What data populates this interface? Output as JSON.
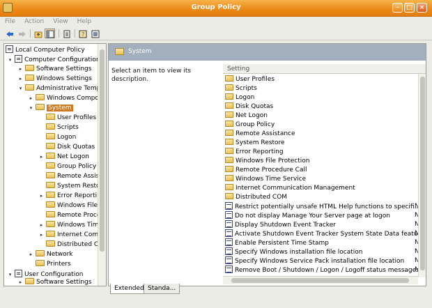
{
  "window": {
    "title": "Group Policy"
  },
  "menu": [
    "File",
    "Action",
    "View",
    "Help"
  ],
  "toolbar": [
    "back-icon",
    "forward-icon",
    "up-folder-icon",
    "show-hide-tree-icon",
    "properties-icon",
    "help-icon",
    "export-list-icon"
  ],
  "tree": [
    {
      "label": "Local Computer Policy",
      "icon": "policy",
      "expander": ""
    },
    {
      "label": "Computer Configuration",
      "icon": "computer",
      "expander": "▾"
    },
    {
      "label": "Software Settings",
      "icon": "folder",
      "expander": "▸"
    },
    {
      "label": "Windows Settings",
      "icon": "folder",
      "expander": "▸"
    },
    {
      "label": "Administrative Templ",
      "icon": "folder",
      "expander": "▾"
    },
    {
      "label": "Windows Compo",
      "icon": "folder",
      "expander": "▸"
    },
    {
      "label": "System",
      "icon": "folder",
      "expander": "▾",
      "selected": true
    },
    {
      "label": "User Profiles",
      "icon": "folder",
      "expander": ""
    },
    {
      "label": "Scripts",
      "icon": "folder",
      "expander": ""
    },
    {
      "label": "Logon",
      "icon": "folder",
      "expander": ""
    },
    {
      "label": "Disk Quotas",
      "icon": "folder",
      "expander": ""
    },
    {
      "label": "Net Logon",
      "icon": "folder",
      "expander": "▸"
    },
    {
      "label": "Group Policy",
      "icon": "folder",
      "expander": ""
    },
    {
      "label": "Remote Assist",
      "icon": "folder",
      "expander": ""
    },
    {
      "label": "System Restor",
      "icon": "folder",
      "expander": ""
    },
    {
      "label": "Error Reportir",
      "icon": "folder",
      "expander": "▸"
    },
    {
      "label": "Windows File",
      "icon": "folder",
      "expander": ""
    },
    {
      "label": "Remote Proce",
      "icon": "folder",
      "expander": ""
    },
    {
      "label": "Windows Tim",
      "icon": "folder",
      "expander": "▸"
    },
    {
      "label": "Internet Comr",
      "icon": "folder",
      "expander": "▸"
    },
    {
      "label": "Distributed C",
      "icon": "folder",
      "expander": ""
    },
    {
      "label": "Network",
      "icon": "folder",
      "expander": "▸"
    },
    {
      "label": "Printers",
      "icon": "folder",
      "expander": ""
    },
    {
      "label": "User Configuration",
      "icon": "user",
      "expander": "▾"
    },
    {
      "label": "Software Settings",
      "icon": "folder",
      "expander": "▸"
    }
  ],
  "main": {
    "header_title": "System",
    "description": "Select an item to view its description.",
    "column_setting": "Setting",
    "items": [
      {
        "label": "User Profiles",
        "type": "folder"
      },
      {
        "label": "Scripts",
        "type": "folder"
      },
      {
        "label": "Logon",
        "type": "folder"
      },
      {
        "label": "Disk Quotas",
        "type": "folder"
      },
      {
        "label": "Net Logon",
        "type": "folder"
      },
      {
        "label": "Group Policy",
        "type": "folder"
      },
      {
        "label": "Remote Assistance",
        "type": "folder"
      },
      {
        "label": "System Restore",
        "type": "folder"
      },
      {
        "label": "Error Reporting",
        "type": "folder"
      },
      {
        "label": "Windows File Protection",
        "type": "folder"
      },
      {
        "label": "Remote Procedure Call",
        "type": "folder"
      },
      {
        "label": "Windows Time Service",
        "type": "folder"
      },
      {
        "label": "Internet Communication Management",
        "type": "folder"
      },
      {
        "label": "Distributed COM",
        "type": "folder"
      },
      {
        "label": "Restrict potentially unsafe HTML Help functions to specifi...",
        "type": "policy",
        "state": "N"
      },
      {
        "label": "Do not display Manage Your Server page at logon",
        "type": "policy",
        "state": "N"
      },
      {
        "label": "Display Shutdown Event Tracker",
        "type": "policy",
        "state": "N"
      },
      {
        "label": "Activate Shutdown Event Tracker System State Data feature",
        "type": "policy",
        "state": "N"
      },
      {
        "label": "Enable Persistent Time Stamp",
        "type": "policy",
        "state": "N"
      },
      {
        "label": "Specify Windows installation file location",
        "type": "policy",
        "state": "N"
      },
      {
        "label": "Specify Windows Service Pack installation file location",
        "type": "policy",
        "state": "N"
      },
      {
        "label": "Remove Boot / Shutdown / Logon / Logoff status messages",
        "type": "policy",
        "state": "N"
      }
    ]
  },
  "tabs": [
    "Extended",
    "Standa..."
  ]
}
